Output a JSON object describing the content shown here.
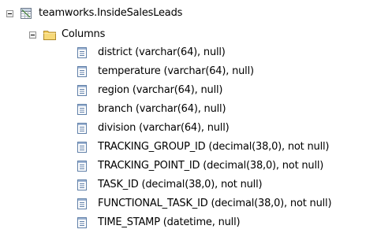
{
  "tree": {
    "table": {
      "label": "teamworks.InsideSalesLeads",
      "icon": "table-icon",
      "expanded": true
    },
    "folder": {
      "label": "Columns",
      "icon": "folder-icon",
      "expanded": true
    },
    "columns": [
      {
        "label": "district (varchar(64), null)",
        "icon": "column-icon"
      },
      {
        "label": "temperature (varchar(64), null)",
        "icon": "column-icon"
      },
      {
        "label": "region (varchar(64), null)",
        "icon": "column-icon"
      },
      {
        "label": "branch (varchar(64), null)",
        "icon": "column-icon"
      },
      {
        "label": "division (varchar(64), null)",
        "icon": "column-icon"
      },
      {
        "label": "TRACKING_GROUP_ID (decimal(38,0), not null)",
        "icon": "column-icon"
      },
      {
        "label": "TRACKING_POINT_ID (decimal(38,0), not null)",
        "icon": "column-icon"
      },
      {
        "label": "TASK_ID (decimal(38,0), not null)",
        "icon": "column-icon"
      },
      {
        "label": "FUNCTIONAL_TASK_ID (decimal(38,0), not null)",
        "icon": "column-icon"
      },
      {
        "label": "TIME_STAMP (datetime, null)",
        "icon": "column-icon"
      }
    ]
  }
}
